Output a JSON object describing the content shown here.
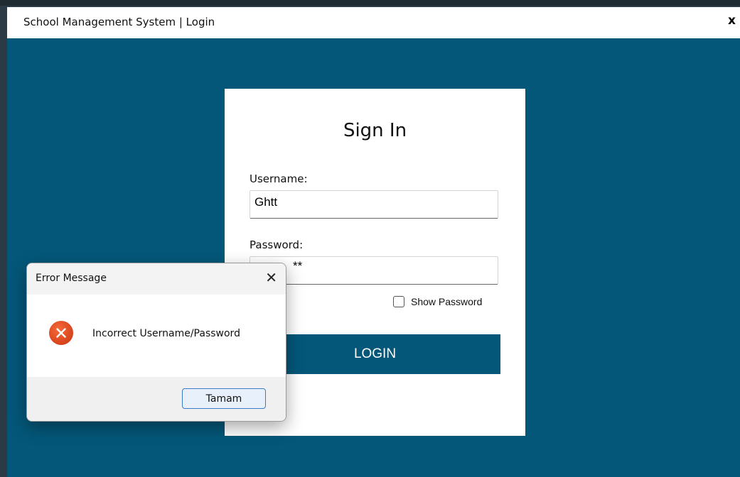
{
  "window": {
    "title": "School Management System | Login",
    "close_label": "x",
    "background_color": "#045779"
  },
  "login": {
    "heading": "Sign In",
    "username_label": "Username:",
    "username_value": "Ghtt",
    "password_label": "Password:",
    "password_value": "**",
    "show_password_label": "Show Password",
    "show_password_checked": false,
    "login_button": "LOGIN"
  },
  "dialog": {
    "title": "Error Message",
    "close_label": "✕",
    "message": "Incorrect Username/Password",
    "icon": "error-icon",
    "ok_button": "Tamam"
  },
  "colors": {
    "accent": "#045779",
    "error": "#d8431c",
    "dialog_button_border": "#3b7ac9"
  }
}
